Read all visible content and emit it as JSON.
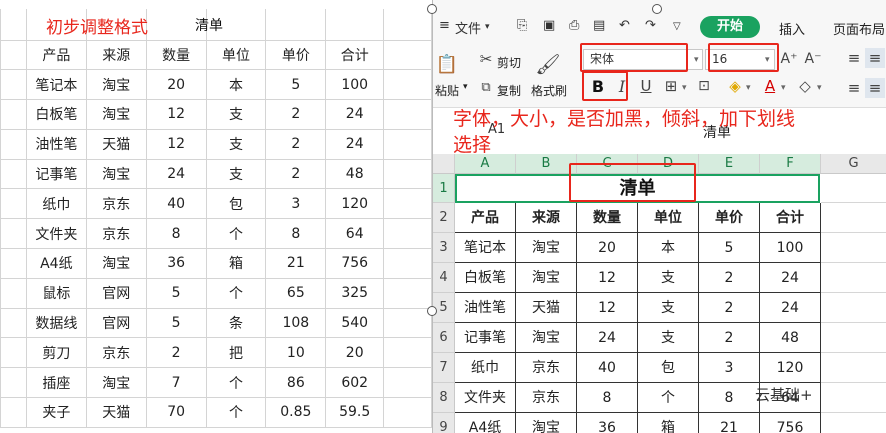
{
  "left_sheet": {
    "caption": "初步调整格式",
    "title": "清单",
    "headers": [
      "产品",
      "来源",
      "数量",
      "单位",
      "单价",
      "合计"
    ],
    "rows": [
      [
        "笔记本",
        "淘宝",
        "20",
        "本",
        "5",
        "100"
      ],
      [
        "白板笔",
        "淘宝",
        "12",
        "支",
        "2",
        "24"
      ],
      [
        "油性笔",
        "天猫",
        "12",
        "支",
        "2",
        "24"
      ],
      [
        "记事笔",
        "淘宝",
        "24",
        "支",
        "2",
        "48"
      ],
      [
        "纸巾",
        "京东",
        "40",
        "包",
        "3",
        "120"
      ],
      [
        "文件夹",
        "京东",
        "8",
        "个",
        "8",
        "64"
      ],
      [
        "A4纸",
        "淘宝",
        "36",
        "箱",
        "21",
        "756"
      ],
      [
        "鼠标",
        "官网",
        "5",
        "个",
        "65",
        "325"
      ],
      [
        "数据线",
        "官网",
        "5",
        "条",
        "108",
        "540"
      ],
      [
        "剪刀",
        "京东",
        "2",
        "把",
        "10",
        "20"
      ],
      [
        "插座",
        "淘宝",
        "7",
        "个",
        "86",
        "602"
      ],
      [
        "夹子",
        "天猫",
        "70",
        "个",
        "0.85",
        "59.5"
      ]
    ]
  },
  "app": {
    "menu": {
      "file": "文件",
      "start": "开始",
      "insert": "插入",
      "layout": "页面布局"
    },
    "toolbar": {
      "cut": "剪切",
      "copy": "复制",
      "paste": "粘贴",
      "format_painter": "格式刷",
      "font_name": "宋体",
      "font_size": "16",
      "bold": "B",
      "italic": "I",
      "underline": "U"
    },
    "annotation_line1": "字体，大小，是否加黑，倾斜，加下划线",
    "annotation_line2": "选择",
    "formula_bar": {
      "cell_ref": "A1",
      "content": "清单"
    },
    "columns": [
      "A",
      "B",
      "C",
      "D",
      "E",
      "F",
      "G"
    ],
    "row_numbers": [
      "1",
      "2",
      "3",
      "4",
      "5",
      "6",
      "7",
      "8",
      "9"
    ],
    "merged_title": "清单",
    "headers": [
      "产品",
      "来源",
      "数量",
      "单位",
      "单价",
      "合计"
    ],
    "rows": [
      [
        "笔记本",
        "淘宝",
        "20",
        "本",
        "5",
        "100"
      ],
      [
        "白板笔",
        "淘宝",
        "12",
        "支",
        "2",
        "24"
      ],
      [
        "油性笔",
        "天猫",
        "12",
        "支",
        "2",
        "24"
      ],
      [
        "记事笔",
        "淘宝",
        "24",
        "支",
        "2",
        "48"
      ],
      [
        "纸巾",
        "京东",
        "40",
        "包",
        "3",
        "120"
      ],
      [
        "文件夹",
        "京东",
        "8",
        "个",
        "8",
        "64"
      ],
      [
        "A4纸",
        "淘宝",
        "36",
        "箱",
        "21",
        "756"
      ]
    ],
    "watermark": "云基础+"
  },
  "colors": {
    "accent_red": "#e8261c",
    "accent_green": "#1aa260"
  }
}
